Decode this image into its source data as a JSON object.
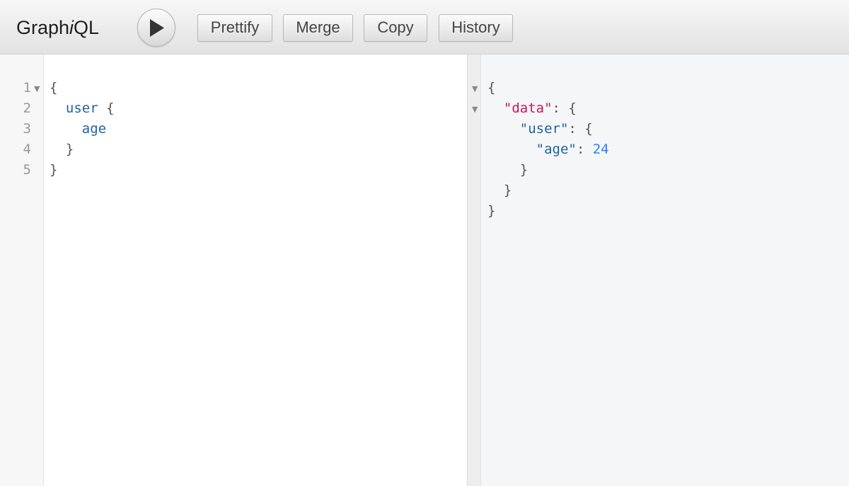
{
  "app": {
    "title_prefix": "Graph",
    "title_italic": "i",
    "title_suffix": "QL"
  },
  "toolbar": {
    "execute_icon": "play-icon",
    "buttons": [
      {
        "label": "Prettify"
      },
      {
        "label": "Merge"
      },
      {
        "label": "Copy"
      },
      {
        "label": "History"
      }
    ]
  },
  "query_editor": {
    "line_numbers": [
      "1",
      "2",
      "3",
      "4",
      "5"
    ],
    "lines": [
      {
        "indent": "",
        "field": "",
        "punct": "{"
      },
      {
        "indent": "  ",
        "field": "user",
        "punct": " {"
      },
      {
        "indent": "    ",
        "field": "age",
        "punct": ""
      },
      {
        "indent": "  ",
        "field": "",
        "punct": "}"
      },
      {
        "indent": "",
        "field": "",
        "punct": "}"
      }
    ]
  },
  "result_viewer": {
    "open_brace": "{",
    "data_key": "\"data\"",
    "colon_brace": ": {",
    "user_key": "\"user\"",
    "age_key": "\"age\"",
    "colon": ": ",
    "age_value": "24",
    "close_user": "}",
    "close_data": "}",
    "close_root": "}"
  },
  "colors": {
    "field": "#1f61a0",
    "json_key": "#c6195a",
    "json_number": "#2882f9",
    "result_bg": "#f5f6f8"
  }
}
